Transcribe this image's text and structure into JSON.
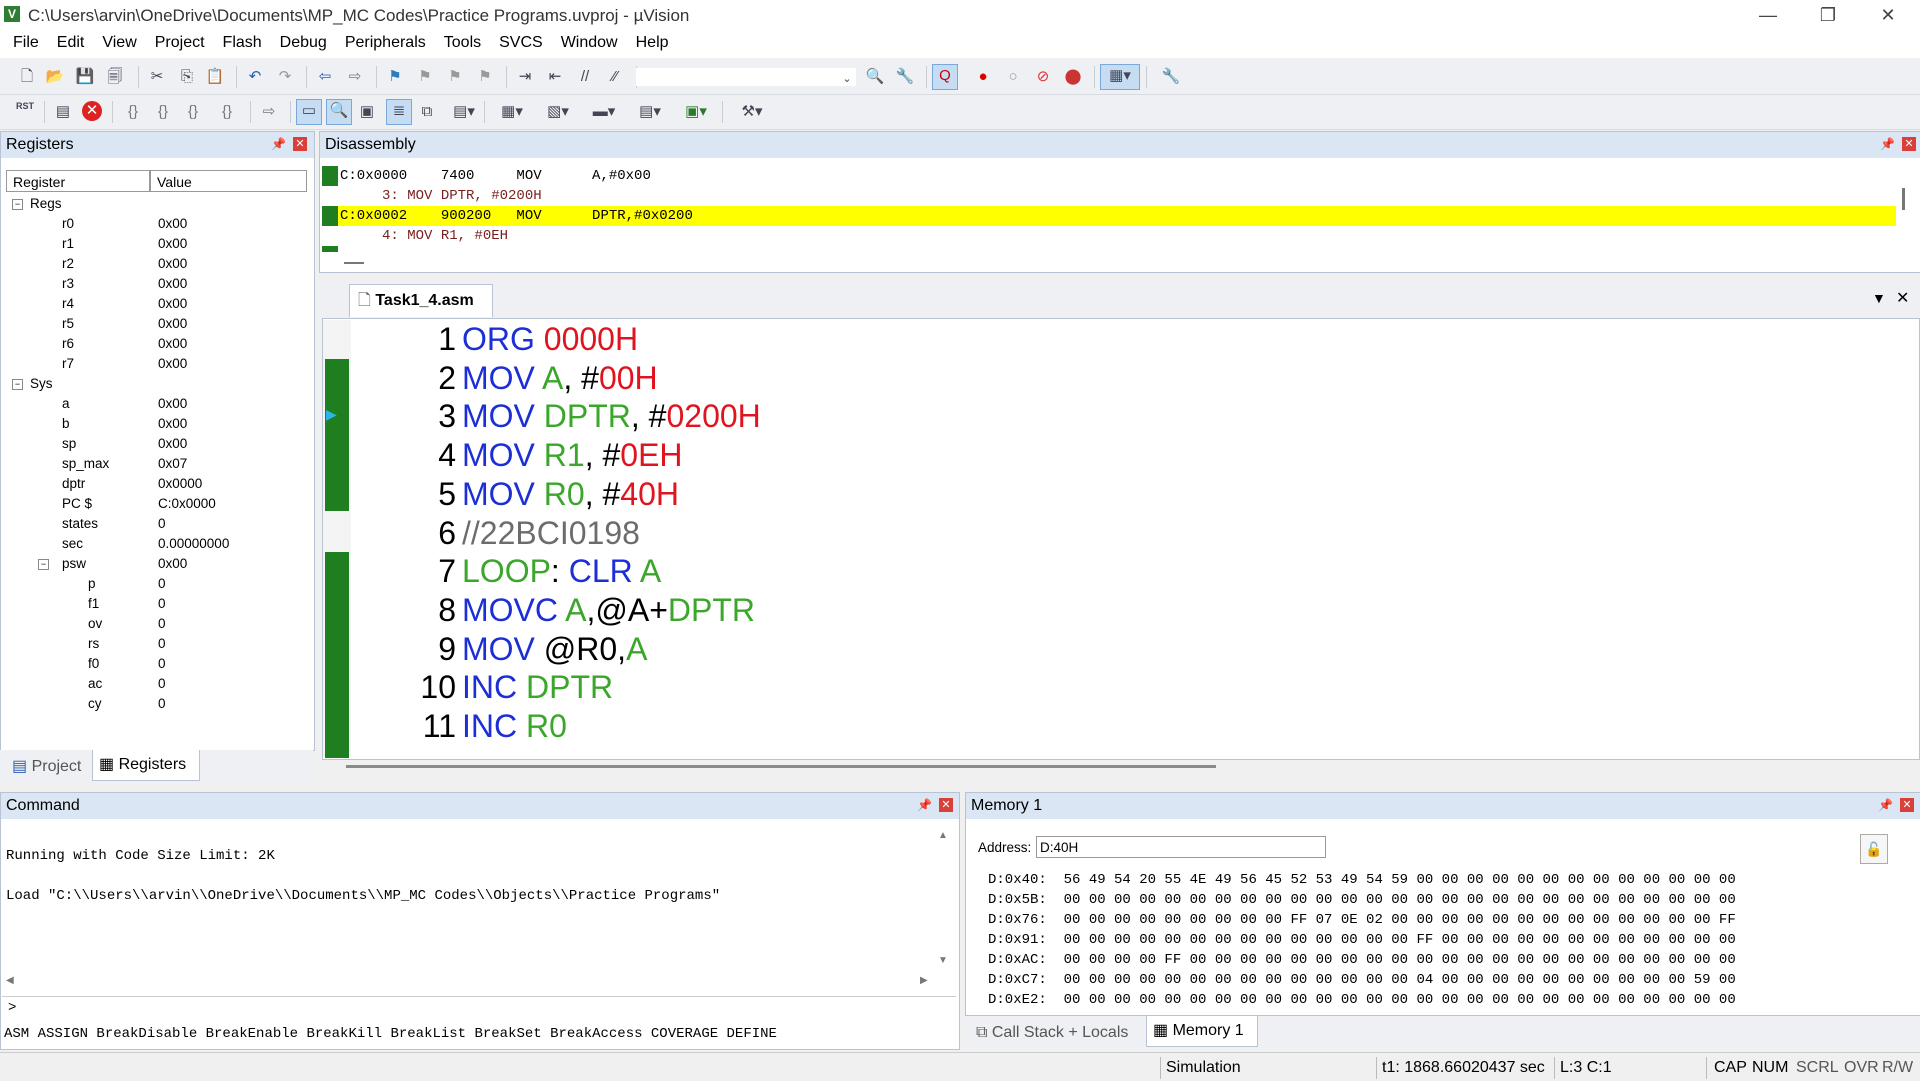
{
  "window": {
    "title": "C:\\Users\\arvin\\OneDrive\\Documents\\MP_MC Codes\\Practice Programs.uvproj - µVision",
    "controls": {
      "minimize": "—",
      "restore": "❐",
      "close": "✕"
    }
  },
  "menu": [
    "File",
    "Edit",
    "View",
    "Project",
    "Flash",
    "Debug",
    "Peripherals",
    "Tools",
    "SVCS",
    "Window",
    "Help"
  ],
  "toolbar2": {
    "rst_label": "RST"
  },
  "registers": {
    "panel_title": "Registers",
    "col_register": "Register",
    "col_value": "Value",
    "groups": [
      {
        "name": "Regs",
        "toggle": "−",
        "items": [
          {
            "name": "r0",
            "value": "0x00"
          },
          {
            "name": "r1",
            "value": "0x00"
          },
          {
            "name": "r2",
            "value": "0x00"
          },
          {
            "name": "r3",
            "value": "0x00"
          },
          {
            "name": "r4",
            "value": "0x00"
          },
          {
            "name": "r5",
            "value": "0x00"
          },
          {
            "name": "r6",
            "value": "0x00"
          },
          {
            "name": "r7",
            "value": "0x00"
          }
        ]
      },
      {
        "name": "Sys",
        "toggle": "−",
        "items": [
          {
            "name": "a",
            "value": "0x00"
          },
          {
            "name": "b",
            "value": "0x00"
          },
          {
            "name": "sp",
            "value": "0x00"
          },
          {
            "name": "sp_max",
            "value": "0x07"
          },
          {
            "name": "dptr",
            "value": "0x0000"
          },
          {
            "name": "PC  $",
            "value": "C:0x0000"
          },
          {
            "name": "states",
            "value": "0"
          },
          {
            "name": "sec",
            "value": "0.00000000"
          }
        ]
      },
      {
        "name": "psw",
        "value": "0x00",
        "toggle": "−",
        "items": [
          {
            "name": "p",
            "value": "0"
          },
          {
            "name": "f1",
            "value": "0"
          },
          {
            "name": "ov",
            "value": "0"
          },
          {
            "name": "rs",
            "value": "0"
          },
          {
            "name": "f0",
            "value": "0"
          },
          {
            "name": "ac",
            "value": "0"
          },
          {
            "name": "cy",
            "value": "0"
          }
        ]
      }
    ],
    "tabs": [
      "Project",
      "Registers"
    ]
  },
  "disassembly": {
    "panel_title": "Disassembly",
    "lines": [
      {
        "text": "C:0x0000    7400     MOV      A,#0x00",
        "type": "asm"
      },
      {
        "text": "     3: MOV DPTR, #0200H",
        "type": "src"
      },
      {
        "text": "C:0x0002    900200   MOV      DPTR,#0x0200",
        "type": "current"
      },
      {
        "text": "     4: MOV R1, #0EH",
        "type": "src"
      }
    ]
  },
  "editor": {
    "tab_label": "Task1_4.asm",
    "lines": [
      {
        "n": "1",
        "parts": [
          {
            "t": "ORG ",
            "c": "kw"
          },
          {
            "t": "0000H",
            "c": "num"
          }
        ]
      },
      {
        "n": "2",
        "parts": [
          {
            "t": "MOV ",
            "c": "kw"
          },
          {
            "t": "A",
            "c": "reg"
          },
          {
            "t": ", #",
            "c": ""
          },
          {
            "t": "00H",
            "c": "num"
          }
        ]
      },
      {
        "n": "3",
        "parts": [
          {
            "t": "MOV ",
            "c": "kw"
          },
          {
            "t": "DPTR",
            "c": "reg"
          },
          {
            "t": ", #",
            "c": ""
          },
          {
            "t": "0200H",
            "c": "num"
          }
        ]
      },
      {
        "n": "4",
        "parts": [
          {
            "t": "MOV ",
            "c": "kw"
          },
          {
            "t": "R1",
            "c": "reg"
          },
          {
            "t": ", #",
            "c": ""
          },
          {
            "t": "0EH",
            "c": "num"
          }
        ]
      },
      {
        "n": "5",
        "parts": [
          {
            "t": "MOV ",
            "c": "kw"
          },
          {
            "t": "R0",
            "c": "reg"
          },
          {
            "t": ", #",
            "c": ""
          },
          {
            "t": "40H",
            "c": "num"
          }
        ]
      },
      {
        "n": "6",
        "parts": [
          {
            "t": "//22BCI0198",
            "c": "cmt"
          }
        ]
      },
      {
        "n": "7",
        "parts": [
          {
            "t": "LOOP",
            "c": "lbl"
          },
          {
            "t": ": ",
            "c": ""
          },
          {
            "t": "CLR ",
            "c": "kw"
          },
          {
            "t": "A",
            "c": "reg"
          }
        ]
      },
      {
        "n": "8",
        "parts": [
          {
            "t": "MOVC ",
            "c": "kw"
          },
          {
            "t": "A",
            "c": "reg"
          },
          {
            "t": ",@A+",
            "c": ""
          },
          {
            "t": "DPTR",
            "c": "reg"
          }
        ]
      },
      {
        "n": "9",
        "parts": [
          {
            "t": "MOV ",
            "c": "kw"
          },
          {
            "t": "@R0,",
            "c": ""
          },
          {
            "t": "A",
            "c": "reg"
          }
        ]
      },
      {
        "n": "10",
        "parts": [
          {
            "t": "INC ",
            "c": "kw"
          },
          {
            "t": "DPTR",
            "c": "reg"
          }
        ]
      },
      {
        "n": "11",
        "parts": [
          {
            "t": "INC ",
            "c": "kw"
          },
          {
            "t": "R0",
            "c": "reg"
          }
        ]
      }
    ]
  },
  "command": {
    "panel_title": "Command",
    "output": [
      "Running with Code Size Limit: 2K",
      "Load \"C:\\\\Users\\\\arvin\\\\OneDrive\\\\Documents\\\\MP_MC Codes\\\\Objects\\\\Practice Programs\""
    ],
    "prompt": ">",
    "hint": "ASM ASSIGN BreakDisable BreakEnable BreakKill BreakList BreakSet BreakAccess COVERAGE DEFINE"
  },
  "memory": {
    "panel_title": "Memory 1",
    "address_label": "Address:",
    "address_value": "D:40H",
    "rows": [
      "D:0x40:  56 49 54 20 55 4E 49 56 45 52 53 49 54 59 00 00 00 00 00 00 00 00 00 00 00 00 00",
      "D:0x5B:  00 00 00 00 00 00 00 00 00 00 00 00 00 00 00 00 00 00 00 00 00 00 00 00 00 00 00",
      "D:0x76:  00 00 00 00 00 00 00 00 00 FF 07 0E 02 00 00 00 00 00 00 00 00 00 00 00 00 00 FF",
      "D:0x91:  00 00 00 00 00 00 00 00 00 00 00 00 00 00 FF 00 00 00 00 00 00 00 00 00 00 00 00",
      "D:0xAC:  00 00 00 00 FF 00 00 00 00 00 00 00 00 00 00 00 00 00 00 00 00 00 00 00 00 00 00",
      "D:0xC7:  00 00 00 00 00 00 00 00 00 00 00 00 00 00 04 00 00 00 00 00 00 00 00 00 00 59 00",
      "D:0xE2:  00 00 00 00 00 00 00 00 00 00 00 00 00 00 00 00 00 00 00 00 00 00 00 00 00 00 00"
    ],
    "tabs": [
      "Call Stack + Locals",
      "Memory 1"
    ]
  },
  "status": {
    "mode": "Simulation",
    "time": "t1: 1868.66020437 sec",
    "cursor": "L:3 C:1",
    "indicators": [
      "CAP",
      "NUM",
      "SCRL",
      "OVR",
      "R/W"
    ]
  },
  "colors": {
    "accent_green": "#1f7e1f",
    "highlight_yellow": "#ffff00",
    "keyword_blue": "#1c2fd6",
    "number_red": "#e0141e"
  }
}
